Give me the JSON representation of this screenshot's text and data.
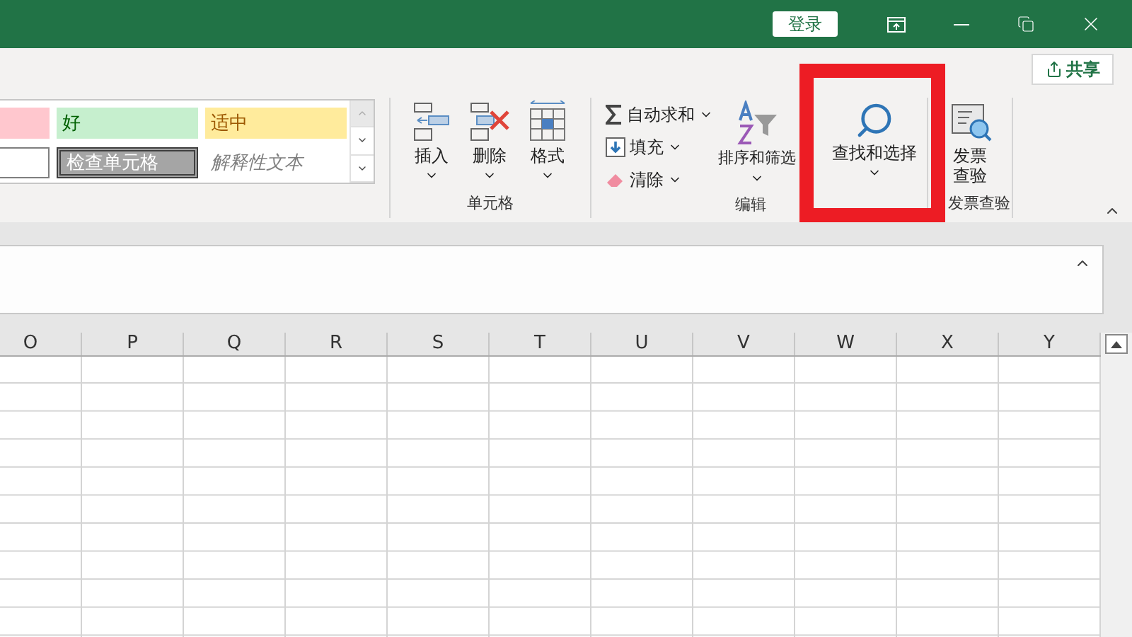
{
  "title_bar": {
    "sign_in": "登录"
  },
  "share": {
    "label": "共享"
  },
  "styles_gallery": {
    "cells": [
      {
        "kind": "bad"
      },
      {
        "label": "好",
        "kind": "good"
      },
      {
        "label": "适中",
        "kind": "neutral"
      },
      {
        "kind": "blank"
      },
      {
        "label": "检查单元格",
        "kind": "check"
      },
      {
        "label": "解释性文本",
        "kind": "explanatory"
      }
    ]
  },
  "cells_group": {
    "label": "单元格",
    "buttons": [
      {
        "label": "插入",
        "kind": "insert"
      },
      {
        "label": "删除",
        "kind": "delete"
      },
      {
        "label": "格式",
        "kind": "format"
      }
    ]
  },
  "editing_group": {
    "label": "编辑",
    "small_buttons": [
      {
        "label": "自动求和",
        "kind": "sum"
      },
      {
        "label": "填充",
        "kind": "fill"
      },
      {
        "label": "清除",
        "kind": "clear"
      }
    ],
    "large_buttons": [
      {
        "label": "排序和筛选",
        "kind": "sort"
      },
      {
        "label": "查找和选择",
        "kind": "find"
      }
    ]
  },
  "invoice_group": {
    "label": "发票查验",
    "button": {
      "label": "发票查验"
    }
  },
  "sheet": {
    "columns": [
      "O",
      "P",
      "Q",
      "R",
      "S",
      "T",
      "U",
      "V",
      "W",
      "X",
      "Y"
    ]
  },
  "annotation": {
    "kind": "frame"
  }
}
